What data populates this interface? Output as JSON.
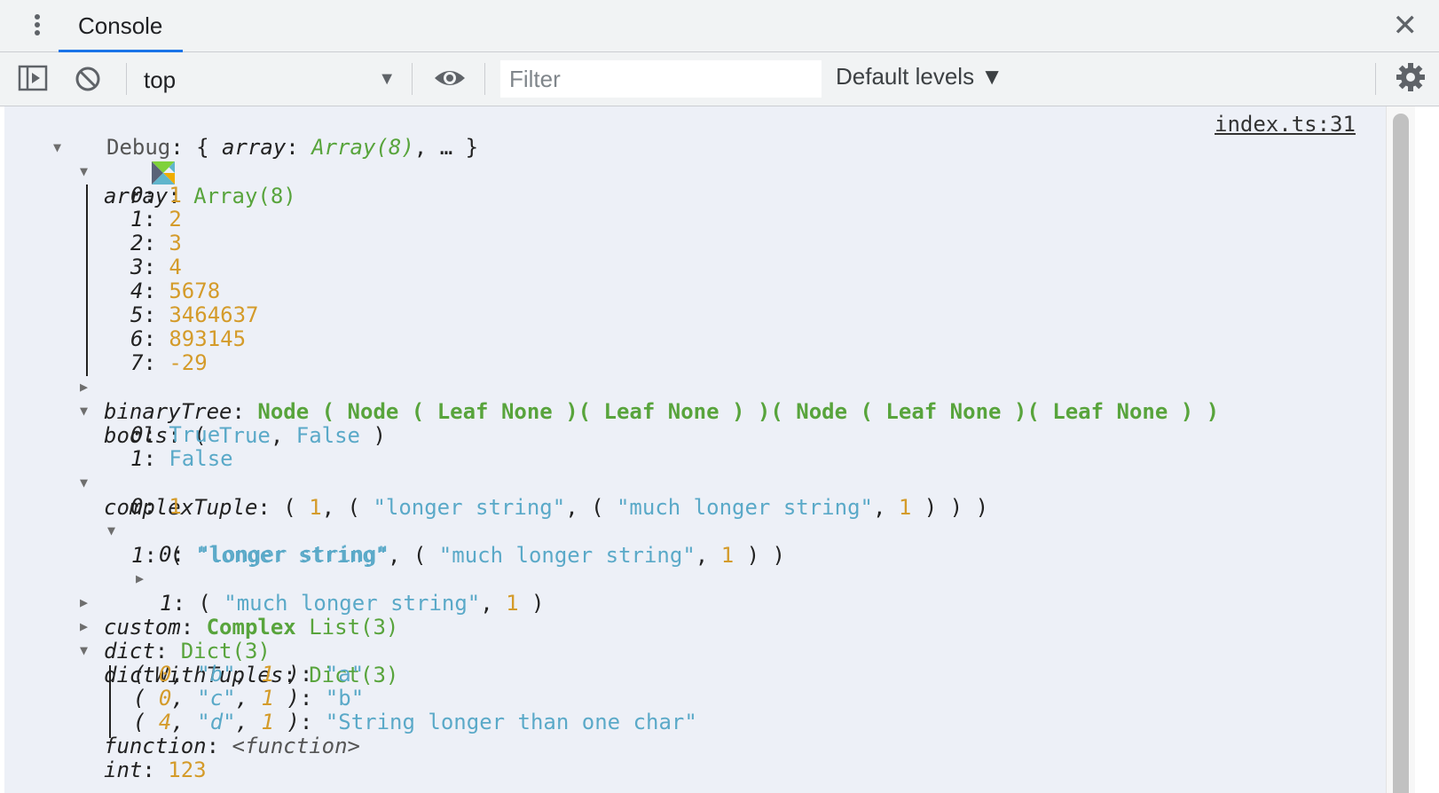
{
  "tabs": {
    "console_label": "Console"
  },
  "toolbar": {
    "context": "top",
    "filter_placeholder": "Filter",
    "levels": "Default levels ▼"
  },
  "console": {
    "source_link": "index.ts:31",
    "root": {
      "label": "Debug",
      "summary_key": "array",
      "summary_val": "Array(8)",
      "ellipsis": ", … }"
    },
    "array": {
      "key": "array",
      "type": "Array(8)",
      "items": [
        {
          "k": "0",
          "v": "1"
        },
        {
          "k": "1",
          "v": "2"
        },
        {
          "k": "2",
          "v": "3"
        },
        {
          "k": "3",
          "v": "4"
        },
        {
          "k": "4",
          "v": "5678"
        },
        {
          "k": "5",
          "v": "3464637"
        },
        {
          "k": "6",
          "v": "893145"
        },
        {
          "k": "7",
          "v": "-29"
        }
      ]
    },
    "binaryTree": {
      "key": "binaryTree",
      "value": "Node ( Node ( Leaf None )( Leaf None ) )( Node ( Leaf None )( Leaf None ) )"
    },
    "bools": {
      "key": "bools",
      "v0": "True",
      "v1": "False",
      "items": [
        {
          "k": "0",
          "v": "True"
        },
        {
          "k": "1",
          "v": "False"
        }
      ]
    },
    "complexTuple": {
      "key": "complexTuple",
      "n1": "1",
      "s1": "\"longer string\"",
      "s2": "\"much longer string\"",
      "n2": "1",
      "i0": {
        "k": "0",
        "v": "1"
      },
      "i1": {
        "k": "1",
        "c0": {
          "k": "0",
          "v": "\"longer string\""
        },
        "c1": {
          "k": "1"
        }
      }
    },
    "custom": {
      "key": "custom",
      "name": "Complex",
      "type": "List(3)"
    },
    "dict": {
      "key": "dict",
      "type": "Dict(3)"
    },
    "dictWithTuples": {
      "key": "dictWithTuples",
      "type": "Dict(3)",
      "entries": [
        {
          "a": "0",
          "b": "\"b\"",
          "c": "1",
          "v": "\"a\""
        },
        {
          "a": "0",
          "b": "\"c\"",
          "c": "1",
          "v": "\"b\""
        },
        {
          "a": "4",
          "b": "\"d\"",
          "c": "1",
          "v": "\"String longer than one char\""
        }
      ]
    },
    "function": {
      "key": "function",
      "value": "<function>"
    },
    "partial_row": {
      "key": "int",
      "value": "123"
    }
  }
}
